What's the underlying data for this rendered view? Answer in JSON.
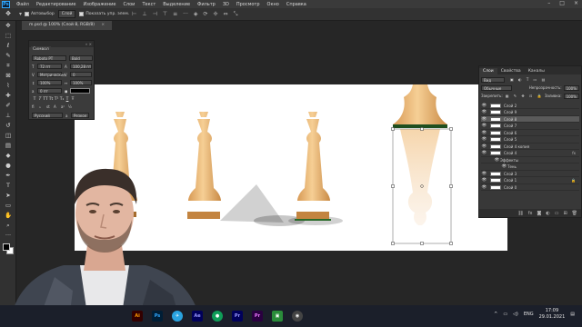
{
  "menubar": {
    "app_logo": "Ps",
    "items": [
      "Файл",
      "Редактирование",
      "Изображение",
      "Слои",
      "Текст",
      "Выделение",
      "Фильтр",
      "3D",
      "Просмотр",
      "Окно",
      "Справка"
    ]
  },
  "options_bar": {
    "auto_select_label": "Автовыбор",
    "auto_select_target": "Слой",
    "show_transform_label": "Показать упр. элем."
  },
  "document_tab": {
    "title": "m.psd @ 100% (Слой 8, RGB/8)",
    "close": "×"
  },
  "character_panel": {
    "title": "Символ",
    "font_family": "Roboto PT",
    "font_style": "Bold",
    "font_size": "72 пт",
    "leading": "100,28 пт",
    "kerning": "Метрические",
    "tracking": "0",
    "vscale": "100%",
    "hscale": "100%",
    "baseline": "0 пт",
    "language": "Русский",
    "antialias": "Резкое",
    "text_buttons": [
      "T",
      "T",
      "TT",
      "Tt",
      "T¹",
      "T₁",
      "T",
      "Ŧ"
    ]
  },
  "layers_panel": {
    "tabs": [
      "Слои",
      "Свойства",
      "Каналы"
    ],
    "kind_filter": "Вид",
    "blend_mode": "Обычные",
    "opacity_label": "Непрозрачность:",
    "opacity": "100%",
    "lock_label": "Закрепить:",
    "fill_label": "Заливка:",
    "fill": "100%",
    "layers": [
      {
        "name": "Слой 2",
        "selected": false,
        "fx": ""
      },
      {
        "name": "Слой 9",
        "selected": false,
        "fx": ""
      },
      {
        "name": "Слой 8",
        "selected": true,
        "fx": ""
      },
      {
        "name": "Слой 7",
        "selected": false,
        "fx": ""
      },
      {
        "name": "Слой 6",
        "selected": false,
        "fx": ""
      },
      {
        "name": "Слой 5",
        "selected": false,
        "fx": ""
      },
      {
        "name": "Слой 4 копия",
        "selected": false,
        "fx": ""
      },
      {
        "name": "Слой 4",
        "selected": false,
        "fx": "fx"
      },
      {
        "name": "Эффекты",
        "selected": false,
        "fx": ""
      },
      {
        "name": "Тень",
        "selected": false,
        "fx": ""
      },
      {
        "name": "Слой 3",
        "selected": false,
        "fx": ""
      },
      {
        "name": "Слой 1",
        "selected": false,
        "fx": ""
      },
      {
        "name": "Слой 0",
        "selected": false,
        "fx": ""
      }
    ]
  },
  "taskbar": {
    "apps": [
      {
        "label": "Ai",
        "color": "#ff9a00",
        "bg": "#330000"
      },
      {
        "label": "Ps",
        "color": "#31a8ff",
        "bg": "#001e36"
      },
      {
        "label": "✈",
        "color": "#ffffff",
        "bg": "#2aa3e0"
      },
      {
        "label": "Ae",
        "color": "#9999ff",
        "bg": "#00005b"
      },
      {
        "label": "●",
        "color": "#ffffff",
        "bg": "#0f9d58"
      },
      {
        "label": "Pr",
        "color": "#9999ff",
        "bg": "#00005b"
      },
      {
        "label": "Pr",
        "color": "#ea77ff",
        "bg": "#2a0040"
      },
      {
        "label": "▣",
        "color": "#ffffff",
        "bg": "#2a8c3a"
      },
      {
        "label": "◉",
        "color": "#ffffff",
        "bg": "#444444"
      }
    ],
    "lang": "ENG",
    "time": "17:09",
    "date": "29.01.2021"
  }
}
